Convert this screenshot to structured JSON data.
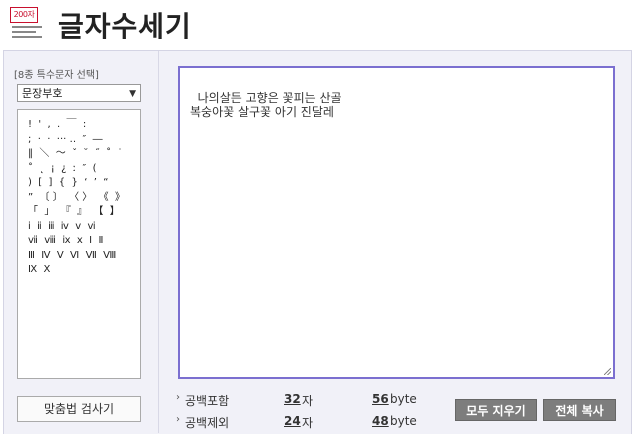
{
  "header": {
    "logo_badge": "200자",
    "title": "글자수세기"
  },
  "symbols": {
    "label": "[8종 특수문자 선택]",
    "selected": "문장부호",
    "arrow": "▼",
    "list_text": "!  '  ,  .  ￣  :\n;  ·  ·  ··· ‥  ″  ―\n‖  ＼  ～  ˇ  ˘  ˝  ˚  ˙\n˚  ˛  ¡  ¿  ː  ″  (\n)  [  ]  {  }  ‘  ’  “\n”  〔 〕  〈 〉  《  》\n「  」  『  』  【  】\nⅰ  ⅱ  ⅲ  ⅳ  ⅴ  ⅵ\nⅶ  ⅷ  ⅸ  ⅹ  Ⅰ  Ⅱ\nⅢ  Ⅳ  Ⅴ  Ⅵ  Ⅶ  Ⅷ\nⅨ  Ⅹ",
    "spell_button": "맞춤법 검사기"
  },
  "editor": {
    "text": "나의살든 고향은 꽃피는 산골\n복숭아꽃 살구꽃 아기 진달레"
  },
  "stats": {
    "arrow": "›",
    "with_space": {
      "label": "공백포함",
      "chars": "32",
      "char_unit": "자",
      "bytes": "56",
      "byte_unit": "byte"
    },
    "without_space": {
      "label": "공백제외",
      "chars": "24",
      "char_unit": "자",
      "bytes": "48",
      "byte_unit": "byte"
    }
  },
  "buttons": {
    "clear_all": "모두 지우기",
    "copy_all": "전체 복사"
  }
}
